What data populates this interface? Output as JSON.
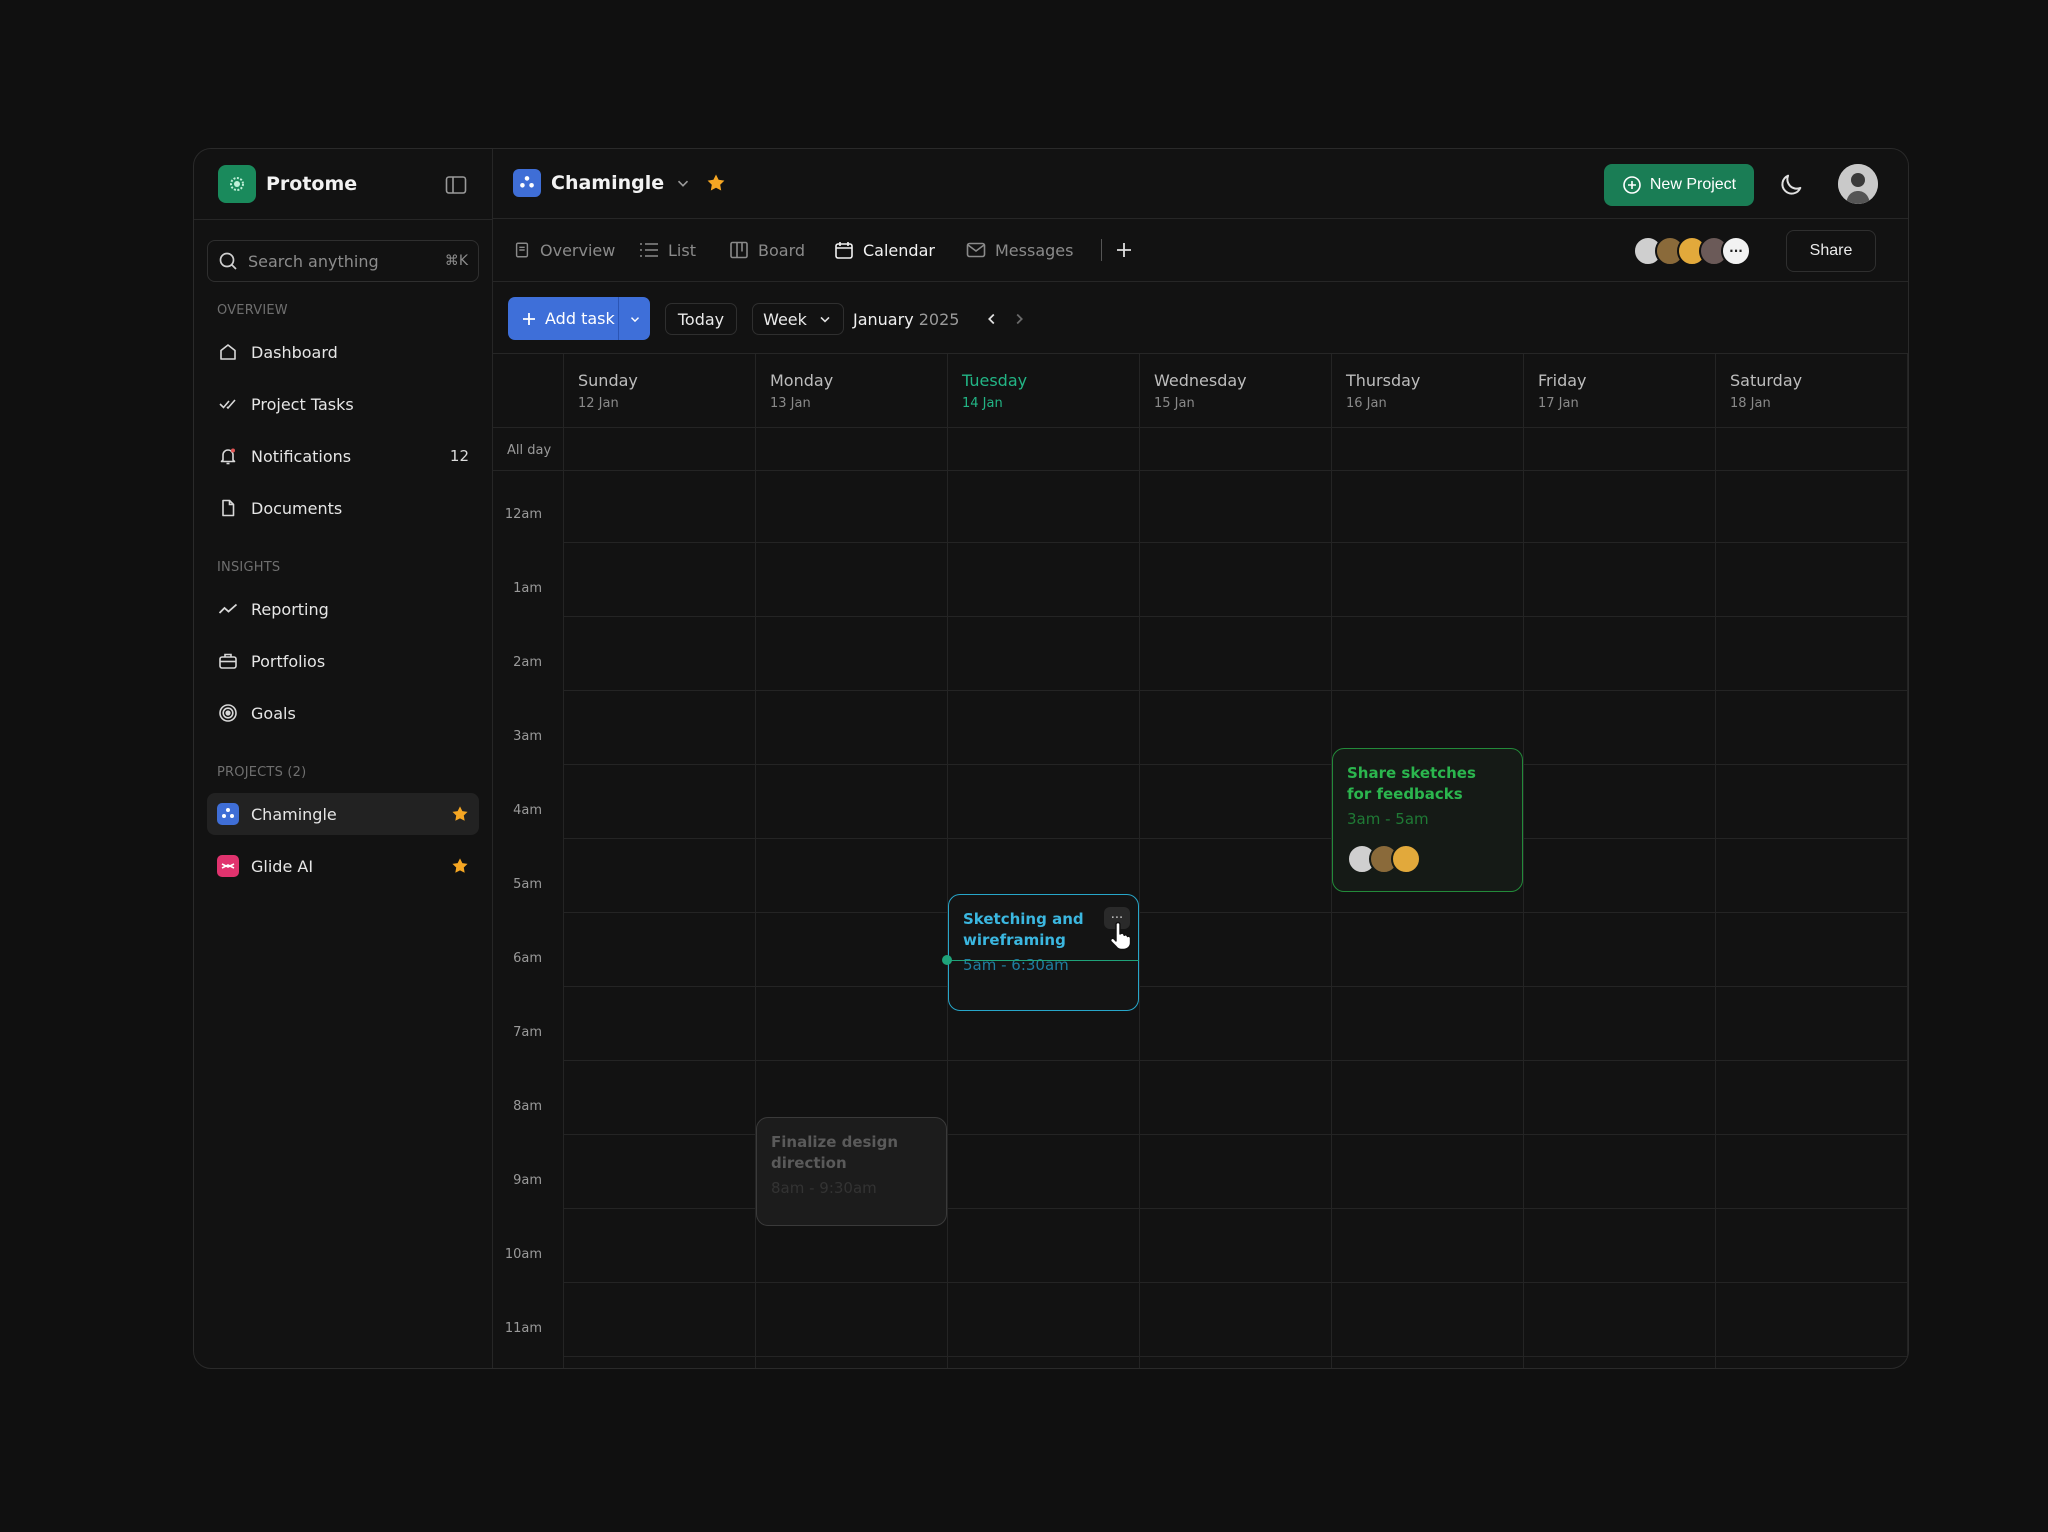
{
  "sidebar": {
    "brand": "Protome",
    "search": {
      "placeholder": "Search anything",
      "shortcut": "⌘K"
    },
    "sections": {
      "overview": "OVERVIEW",
      "insights": "INSIGHTS",
      "projects": "PROJECTS (2)"
    },
    "overview_items": [
      {
        "label": "Dashboard",
        "icon": "home-icon"
      },
      {
        "label": "Project Tasks",
        "icon": "double-check-icon"
      },
      {
        "label": "Notifications",
        "icon": "bell-icon",
        "count": "12"
      },
      {
        "label": "Documents",
        "icon": "file-icon"
      }
    ],
    "insights_items": [
      {
        "label": "Reporting",
        "icon": "trend-icon"
      },
      {
        "label": "Portfolios",
        "icon": "briefcase-icon"
      },
      {
        "label": "Goals",
        "icon": "target-icon"
      }
    ],
    "projects": [
      {
        "label": "Chamingle",
        "color": "#3f6ed6",
        "starred": true
      },
      {
        "label": "Glide AI",
        "color": "#e0336e",
        "starred": true
      }
    ]
  },
  "header": {
    "project_name": "Chamingle",
    "new_project_label": "New Project",
    "share_label": "Share"
  },
  "tabs": [
    {
      "label": "Overview",
      "icon": "doc-icon",
      "active": false
    },
    {
      "label": "List",
      "icon": "list-icon",
      "active": false
    },
    {
      "label": "Board",
      "icon": "board-icon",
      "active": false
    },
    {
      "label": "Calendar",
      "icon": "calendar-icon",
      "active": true
    },
    {
      "label": "Messages",
      "icon": "mail-icon",
      "active": false
    }
  ],
  "toolbar": {
    "add_task_label": "Add task",
    "today_label": "Today",
    "view_label": "Week",
    "month": "January",
    "year": "2025"
  },
  "calendar": {
    "allday_label": "All day",
    "days": [
      {
        "name": "Sunday",
        "date": "12 Jan"
      },
      {
        "name": "Monday",
        "date": "13 Jan"
      },
      {
        "name": "Tuesday",
        "date": "14 Jan",
        "today": true
      },
      {
        "name": "Wednesday",
        "date": "15 Jan"
      },
      {
        "name": "Thursday",
        "date": "16 Jan"
      },
      {
        "name": "Friday",
        "date": "17 Jan"
      },
      {
        "name": "Saturday",
        "date": "18 Jan"
      }
    ],
    "hours": [
      "12am",
      "1am",
      "2am",
      "3am",
      "4am",
      "5am",
      "6am",
      "7am",
      "8am",
      "9am",
      "10am",
      "11am"
    ],
    "events": [
      {
        "title_lines": [
          "Share sketches",
          "for feedbacks"
        ],
        "time": "3am - 5am"
      },
      {
        "title_lines": [
          "Sketching and",
          "wireframing"
        ],
        "time": "5am - 6:30am",
        "more": "···"
      },
      {
        "title_lines": [
          "Finalize design",
          "direction"
        ],
        "time": "8am - 9:30am"
      }
    ]
  },
  "colors": {
    "accent_green": "#1a7d55",
    "today": "#22b585",
    "primary_blue": "#3e6fd9"
  }
}
